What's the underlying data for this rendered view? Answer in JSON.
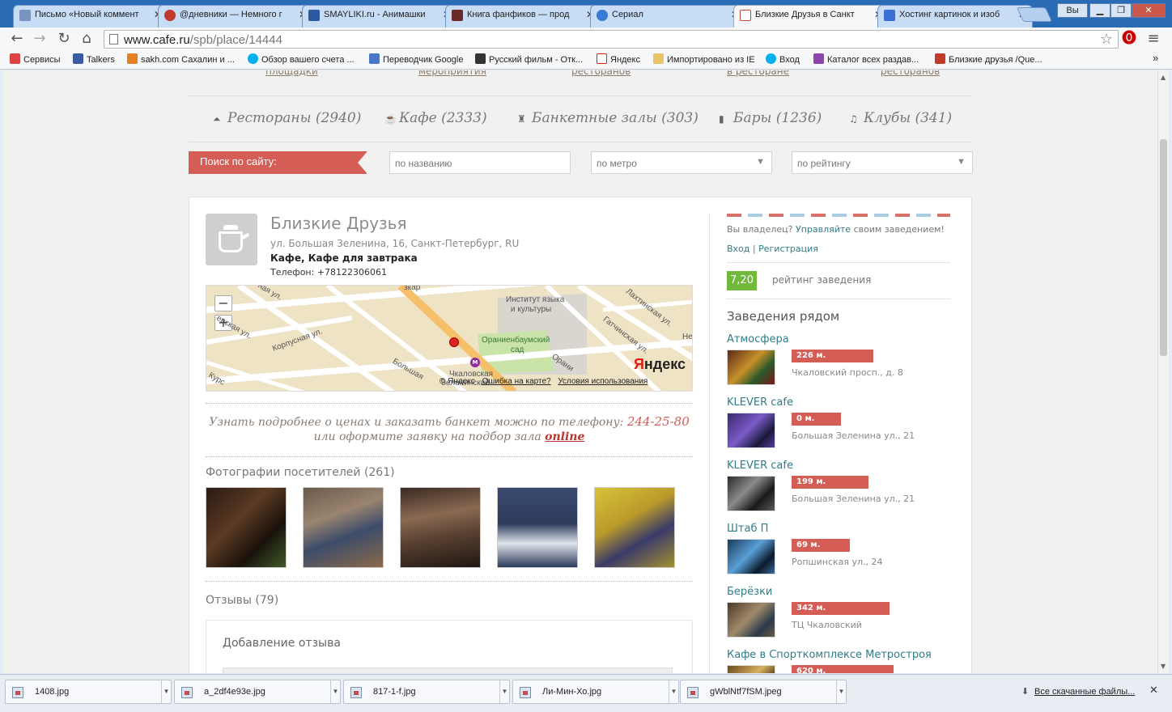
{
  "browser": {
    "tabs": [
      {
        "title": "Письмо «Новый коммент",
        "color": "#7a93c0"
      },
      {
        "title": "@дневники — Немного г",
        "color": "#c0392b"
      },
      {
        "title": "SMAYLIKI.ru - Анимашки",
        "color": "#2c5aa0"
      },
      {
        "title": "Книга фанфиков — прод",
        "color": "#6b2a2a"
      },
      {
        "title": "Сериал",
        "color": "#3a7bd5"
      },
      {
        "title": "Близкие Друзья в Санкт",
        "color": "#b94a3a"
      },
      {
        "title": "Хостинг картинок и изоб",
        "color": "#3a6fd8"
      }
    ],
    "user_button": "Вы",
    "url_domain": "www.cafe.ru",
    "url_path": "/spb/place/14444",
    "bookmarks": [
      {
        "label": "Сервисы",
        "color": "#d44"
      },
      {
        "label": "Talkers",
        "color": "#3b5ba5"
      },
      {
        "label": "sakh.com Сахалин и ...",
        "color": "#e67e22"
      },
      {
        "label": "Обзор вашего счета ...",
        "color": "#00aff0"
      },
      {
        "label": "Переводчик Google",
        "color": "#4a76c9"
      },
      {
        "label": "Русский фильм - Отк...",
        "color": "#333"
      },
      {
        "label": "Яндекс",
        "color": "#e21e12"
      },
      {
        "label": "Импортировано из IE",
        "color": "#e8c468"
      },
      {
        "label": "Вход",
        "color": "#00aff0"
      },
      {
        "label": "Каталог всех раздав...",
        "color": "#8e44ad"
      },
      {
        "label": "Близкие друзья /Que...",
        "color": "#c0392b"
      }
    ],
    "bookmarks_more": "»"
  },
  "site": {
    "top_links": [
      "площадки",
      "мероприятия",
      "ресторанов",
      "в ресторане",
      "ресторанов"
    ],
    "categories": [
      {
        "label": "Рестораны (2940)",
        "icon": "⏶"
      },
      {
        "label": "Кафе (2333)",
        "icon": "☕"
      },
      {
        "label": "Банкетные залы (303)",
        "icon": "♜"
      },
      {
        "label": "Бары (1236)",
        "icon": "▮"
      },
      {
        "label": "Клубы (341)",
        "icon": "♫"
      }
    ],
    "search": {
      "label": "Поиск по сайту:",
      "name_placeholder": "по названию",
      "metro_placeholder": "по метро",
      "rating_placeholder": "по рейтингу"
    }
  },
  "venue": {
    "name": "Близкие Друзья",
    "address": "ул. Большая Зеленина, 16, Санкт-Петербург, RU",
    "type": "Кафе, Кафе для завтрака",
    "phone": "Телефон: +78122306061",
    "map": {
      "streets": [
        "Корпусная ул.",
        "Большая",
        "Лахтинская ул.",
        "Гатчинская ул.",
        "Чкаловская",
        "Зеленинский",
        "Орани",
        "Курс",
        "ерская ул.",
        "ная ул.",
        "зкар",
        "Не"
      ],
      "poi": [
        "Институт языка",
        "и культуры",
        "Ораниенбаумский",
        "сад"
      ],
      "logo_first": "Я",
      "logo_rest": "ндекс",
      "copyright": "© Яндекс",
      "error_link": "Ошибка на карте?",
      "terms_link": "Условия использования",
      "zoom_out": "−",
      "zoom_in": "+"
    },
    "promo_text": "Узнать подробнее о ценах и заказать банкет можно по телефону:",
    "promo_phone": "244-25-80",
    "promo_text2": "или оформите заявку на подбор зала",
    "promo_link": "online",
    "photos_title": "Фотографии посетителей (261)",
    "reviews_title": "Отзывы (79)",
    "add_review": "Добавление отзыва"
  },
  "sidebar": {
    "owner_text": "Вы владелец?",
    "owner_link": "Управляйте",
    "owner_rest": "своим заведением!",
    "login": "Вход",
    "separator": "|",
    "register": "Регистрация",
    "rating": "7,20",
    "rating_label": "рейтинг заведения",
    "nearby_title": "Заведения рядом",
    "nearby": [
      {
        "name": "Атмосфера",
        "distance": "226 м.",
        "address": "Чкаловский просп., д. 8",
        "dist_frac": 0.74
      },
      {
        "name": "KLEVER cafe",
        "distance": "0 м.",
        "address": "Большая Зеленина ул., 21",
        "dist_frac": 0.34
      },
      {
        "name": "KLEVER cafe",
        "distance": "199 м.",
        "address": "Большая Зеленина ул., 21",
        "dist_frac": 0.68
      },
      {
        "name": "Штаб П",
        "distance": "69 м.",
        "address": "Ропшинская ул., 24",
        "dist_frac": 0.45
      },
      {
        "name": "Берёзки",
        "distance": "342 м.",
        "address": "ТЦ Чкаловский",
        "dist_frac": 0.95
      },
      {
        "name": "Кафе в Спорткомплексе Метростроя",
        "distance": "620 м.",
        "address": "",
        "dist_frac": 1.0
      }
    ]
  },
  "downloads": {
    "files": [
      "1408.jpg",
      "a_2df4e93e.jpg",
      "817-1-f.jpg",
      "Ли-Мин-Хо.jpg",
      "gWblNtf7fSM.jpeg"
    ],
    "all_files": "Все скачанные файлы...",
    "close": "✕"
  }
}
